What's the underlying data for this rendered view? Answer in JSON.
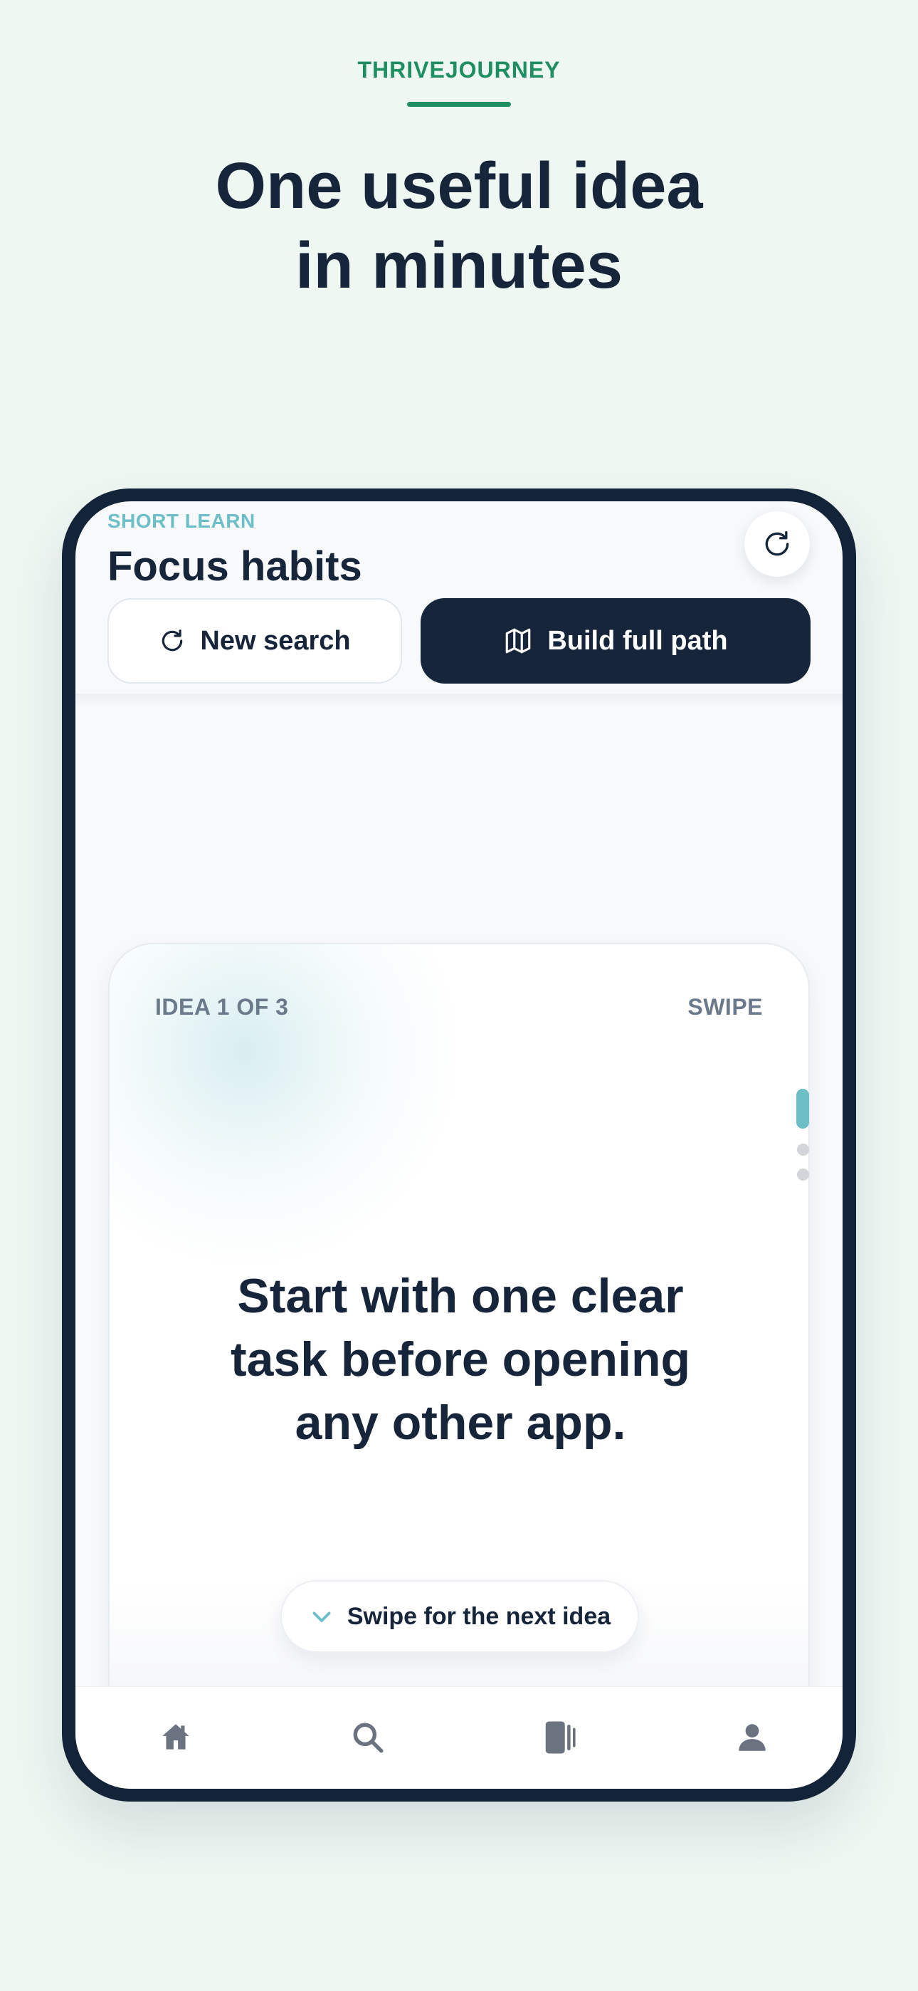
{
  "brand": {
    "name": "THRIVEJOURNEY"
  },
  "headline": {
    "line1": "One useful idea",
    "line2": "in minutes"
  },
  "screen": {
    "section_label": "SHORT LEARN",
    "title": "Focus habits",
    "refresh_icon": "refresh-icon",
    "actions": {
      "new_search": "New search",
      "build_path": "Build full path"
    }
  },
  "card": {
    "counter": "IDEA 1 OF 3",
    "swipe_label": "SWIPE",
    "idea_line1": "Start with one clear",
    "idea_line2": "task before opening",
    "idea_line3": "any other app.",
    "hint": "Swipe for the next idea"
  },
  "pager": {
    "current": 1,
    "total": 3
  },
  "tabs": [
    {
      "icon": "home-icon"
    },
    {
      "icon": "search-icon"
    },
    {
      "icon": "cards-icon"
    },
    {
      "icon": "profile-icon"
    }
  ],
  "colors": {
    "background": "#eff7f3",
    "brand_green": "#1f8f62",
    "ink": "#16253a",
    "accent_teal": "#6cbfc7",
    "muted": "#6b7a8a"
  }
}
